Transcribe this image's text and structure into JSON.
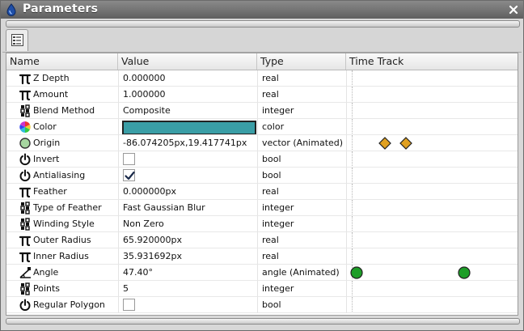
{
  "window": {
    "title": "Parameters"
  },
  "columns": {
    "name": "Name",
    "value": "Value",
    "type": "Type",
    "time_track": "Time Track"
  },
  "params": [
    {
      "icon": "pi-icon",
      "name": "Z Depth",
      "value": "0.000000",
      "type": "real"
    },
    {
      "icon": "pi-icon",
      "name": "Amount",
      "value": "1.000000",
      "type": "real"
    },
    {
      "icon": "list-icon",
      "name": "Blend Method",
      "value": "Composite",
      "type": "integer"
    },
    {
      "icon": "color-wheel-icon",
      "name": "Color",
      "value": "",
      "type": "color",
      "swatch": "#3a9ea6"
    },
    {
      "icon": "origin-point-icon",
      "name": "Origin",
      "value": "-86.074205px,19.417741px",
      "type": "vector (Animated)"
    },
    {
      "icon": "power-icon",
      "name": "Invert",
      "value": "",
      "type": "bool",
      "checked": false
    },
    {
      "icon": "power-icon",
      "name": "Antialiasing",
      "value": "",
      "type": "bool",
      "checked": true
    },
    {
      "icon": "pi-icon",
      "name": "Feather",
      "value": "0.000000px",
      "type": "real"
    },
    {
      "icon": "list-icon",
      "name": "Type of Feather",
      "value": "Fast Gaussian Blur",
      "type": "integer"
    },
    {
      "icon": "list-icon",
      "name": "Winding Style",
      "value": "Non Zero",
      "type": "integer"
    },
    {
      "icon": "pi-icon",
      "name": "Outer Radius",
      "value": "65.920000px",
      "type": "real"
    },
    {
      "icon": "pi-icon",
      "name": "Inner Radius",
      "value": "35.931692px",
      "type": "real"
    },
    {
      "icon": "angle-icon",
      "name": "Angle",
      "value": "47.40°",
      "type": "angle (Animated)"
    },
    {
      "icon": "list-icon",
      "name": "Points",
      "value": "5",
      "type": "integer"
    },
    {
      "icon": "power-icon",
      "name": "Regular Polygon",
      "value": "",
      "type": "bool",
      "checked": false
    }
  ],
  "waypoint_colors": {
    "origin": "#e0a020",
    "angle": "#1e9e28"
  }
}
